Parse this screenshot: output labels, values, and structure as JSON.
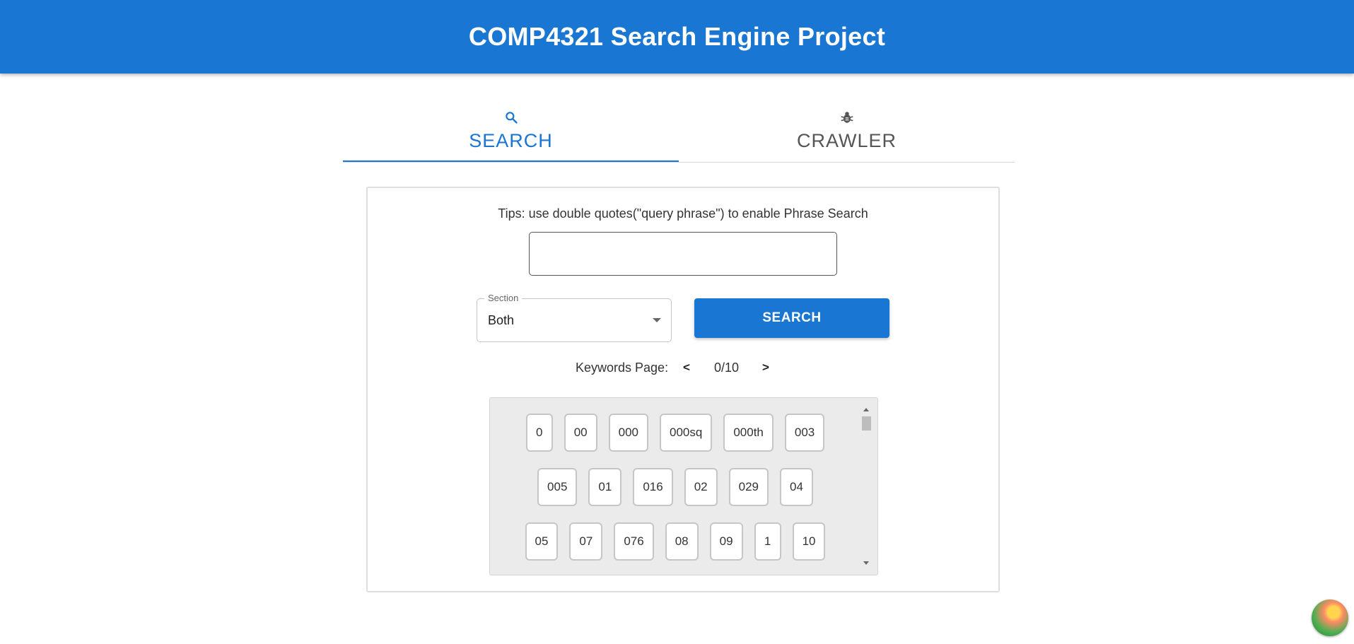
{
  "app": {
    "title": "COMP4321 Search Engine Project"
  },
  "tabs": [
    {
      "label": "Search",
      "icon": "search-icon",
      "active": true
    },
    {
      "label": "Crawler",
      "icon": "bug-icon",
      "active": false
    }
  ],
  "search": {
    "tips": "Tips: use double quotes(\"query phrase\") to enable Phrase Search",
    "query_value": "",
    "section_label": "Section",
    "section_value": "Both",
    "button_label": "Search"
  },
  "keywords": {
    "label": "Keywords Page:",
    "prev": "<",
    "next": ">",
    "page": "0/10",
    "rows": [
      [
        "0",
        "00",
        "000",
        "000sq",
        "000th",
        "003"
      ],
      [
        "005",
        "01",
        "016",
        "02",
        "029",
        "04"
      ],
      [
        "05",
        "07",
        "076",
        "08",
        "09",
        "1",
        "10"
      ]
    ]
  },
  "colors": {
    "primary": "#1976d2",
    "chip_bg": "#ffffff",
    "keyword_box_bg": "#ebebeb"
  }
}
